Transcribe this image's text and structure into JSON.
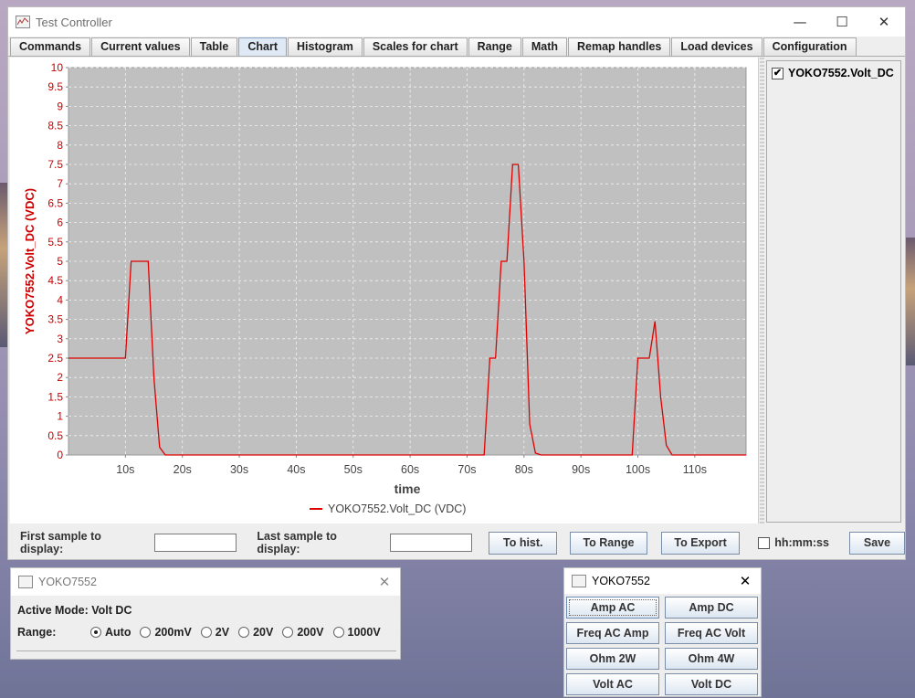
{
  "window": {
    "title": "Test Controller",
    "controls": {
      "minimize": "—",
      "maximize": "☐",
      "close": "✕"
    }
  },
  "tabs": [
    {
      "label": "Commands"
    },
    {
      "label": "Current values"
    },
    {
      "label": "Table"
    },
    {
      "label": "Chart",
      "active": true
    },
    {
      "label": "Histogram"
    },
    {
      "label": "Scales for chart"
    },
    {
      "label": "Range"
    },
    {
      "label": "Math"
    },
    {
      "label": "Remap handles"
    },
    {
      "label": "Load devices"
    },
    {
      "label": "Configuration"
    }
  ],
  "chart_data": {
    "type": "line",
    "xlabel": "time",
    "ylabel": "YOKO7552.Volt_DC (VDC)",
    "xlim": [
      0,
      119
    ],
    "ylim": [
      0,
      10
    ],
    "x_ticks": [
      10,
      20,
      30,
      40,
      50,
      60,
      70,
      80,
      90,
      100,
      110
    ],
    "x_tick_labels": [
      "10s",
      "20s",
      "30s",
      "40s",
      "50s",
      "60s",
      "70s",
      "80s",
      "90s",
      "100s",
      "110s"
    ],
    "y_ticks": [
      0,
      0.5,
      1,
      1.5,
      2,
      2.5,
      3,
      3.5,
      4,
      4.5,
      5,
      5.5,
      6,
      6.5,
      7,
      7.5,
      8,
      8.5,
      9,
      9.5,
      10
    ],
    "y_tick_labels": [
      "0",
      "0.5",
      "1",
      "1.5",
      "2",
      "2.5",
      "3",
      "3.5",
      "4",
      "4.5",
      "5",
      "5.5",
      "6",
      "6.5",
      "7",
      "7.5",
      "8",
      "8.5",
      "9",
      "9.5",
      "10"
    ],
    "grid": true,
    "legend_position": "bottom-center",
    "series": [
      {
        "name": "YOKO7552.Volt_DC (VDC)",
        "color": "#e00000",
        "x": [
          0,
          10,
          11,
          14,
          15,
          16,
          17,
          73,
          74,
          75,
          76,
          77,
          78,
          79,
          80,
          81,
          82,
          83,
          99,
          100,
          101,
          102,
          103,
          104,
          105,
          106,
          119
        ],
        "y": [
          2.5,
          2.5,
          5,
          5,
          2,
          0.2,
          0,
          0,
          2.5,
          2.5,
          5,
          5,
          7.5,
          7.5,
          5,
          0.8,
          0.05,
          0,
          0,
          2.5,
          2.5,
          2.5,
          3.45,
          1.5,
          0.25,
          0,
          0
        ]
      }
    ],
    "plot_bg": "#c0c0c0"
  },
  "series_panel": {
    "items": [
      {
        "label": "YOKO7552.Volt_DC",
        "checked": "✔"
      }
    ]
  },
  "bottom": {
    "first_label": "First sample to display:",
    "first_value": "",
    "last_label": "Last sample to display:",
    "last_value": "",
    "to_hist": "To hist.",
    "to_range": "To Range",
    "to_export": "To Export",
    "hhmmss": "hh:mm:ss",
    "save": "Save"
  },
  "device_window": {
    "title": "YOKO7552",
    "active_mode_label": "Active Mode: Volt DC",
    "range_label": "Range:",
    "options": [
      {
        "label": "Auto",
        "selected": true
      },
      {
        "label": "200mV",
        "selected": false
      },
      {
        "label": "2V",
        "selected": false
      },
      {
        "label": "20V",
        "selected": false
      },
      {
        "label": "200V",
        "selected": false
      },
      {
        "label": "1000V",
        "selected": false
      }
    ]
  },
  "mode_window": {
    "title": "YOKO7552",
    "buttons": [
      "Amp AC",
      "Amp DC",
      "Freq AC Amp",
      "Freq AC Volt",
      "Ohm 2W",
      "Ohm 4W",
      "Volt AC",
      "Volt DC"
    ]
  }
}
